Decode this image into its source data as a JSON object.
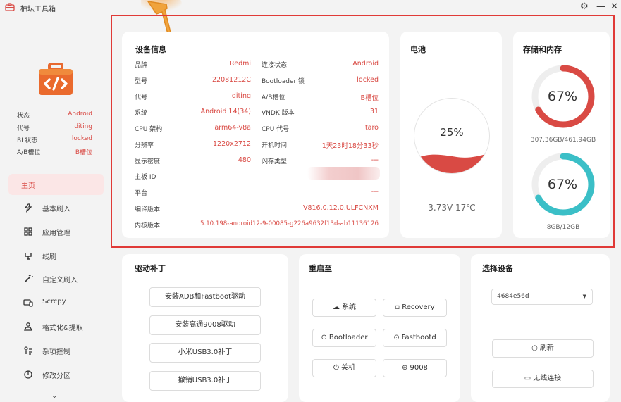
{
  "app": {
    "title": "柚坛工具箱"
  },
  "window": {
    "settings_icon": "gear-icon",
    "minimize": "—",
    "close": "✕"
  },
  "sidebar": {
    "info": [
      {
        "key": "状态",
        "value": "Android"
      },
      {
        "key": "代号",
        "value": "diting"
      },
      {
        "key": "BL状态",
        "value": "locked"
      },
      {
        "key": "A/B槽位",
        "value": "B槽位"
      }
    ],
    "nav": [
      {
        "label": "主页",
        "icon": "home",
        "active": true
      },
      {
        "label": "基本刷入",
        "icon": "flash-icon"
      },
      {
        "label": "应用管理",
        "icon": "apps-icon"
      },
      {
        "label": "线刷",
        "icon": "usb-icon"
      },
      {
        "label": "自定义刷入",
        "icon": "wand-icon"
      },
      {
        "label": "Scrcpy",
        "icon": "screen-cast-icon"
      },
      {
        "label": "格式化&提取",
        "icon": "format-icon"
      },
      {
        "label": "杂项控制",
        "icon": "misc-icon"
      },
      {
        "label": "修改分区",
        "icon": "partition-icon"
      }
    ],
    "more": "⌄"
  },
  "device": {
    "title": "设备信息",
    "left": [
      {
        "key": "品牌",
        "value": "Redmi"
      },
      {
        "key": "型号",
        "value": "22081212C"
      },
      {
        "key": "代号",
        "value": "diting"
      },
      {
        "key": "系统",
        "value": "Android 14(34)"
      },
      {
        "key": "CPU 架构",
        "value": "arm64-v8a"
      },
      {
        "key": "分辨率",
        "value": "1220x2712"
      },
      {
        "key": "显示密度",
        "value": "480"
      }
    ],
    "right": [
      {
        "key": "连接状态",
        "value": "Android"
      },
      {
        "key": "Bootloader 锁",
        "value": "locked"
      },
      {
        "key": "A/B槽位",
        "value": "B槽位"
      },
      {
        "key": "VNDK 版本",
        "value": "31"
      },
      {
        "key": "CPU 代号",
        "value": "taro"
      },
      {
        "key": "开机时间",
        "value": "1天23时18分33秒"
      },
      {
        "key": "闪存类型",
        "value": "---"
      }
    ],
    "full": [
      {
        "key": "主板 ID",
        "value": ""
      },
      {
        "key": "平台",
        "value": "---"
      },
      {
        "key": "编译版本",
        "value": "V816.0.12.0.ULFCNXM"
      },
      {
        "key": "内核版本",
        "value": "5.10.198-android12-9-00085-g226a9632f13d-ab11136126"
      }
    ]
  },
  "battery": {
    "title": "电池",
    "percent": "25%",
    "level": 0.25,
    "status": "3.73V 17℃"
  },
  "storage": {
    "title": "存储和内存",
    "storage_percent": "67%",
    "storage_fraction": 0.67,
    "storage_detail": "307.36GB/461.94GB",
    "memory_percent": "67%",
    "memory_fraction": 0.67,
    "memory_detail": "8GB/12GB"
  },
  "drivers": {
    "title": "驱动补丁",
    "buttons": [
      "安装ADB和Fastboot驱动",
      "安装高通9008驱动",
      "小米USB3.0补丁",
      "撤销USB3.0补丁"
    ]
  },
  "reboot": {
    "title": "重启至",
    "buttons": [
      {
        "label": "系统",
        "icon": "cloud-icon"
      },
      {
        "label": "Recovery",
        "icon": "recovery-icon"
      },
      {
        "label": "Bootloader",
        "icon": "bootloader-icon"
      },
      {
        "label": "Fastbootd",
        "icon": "fastbootd-icon"
      },
      {
        "label": "关机",
        "icon": "power-icon"
      },
      {
        "label": "9008",
        "icon": "edl-icon"
      }
    ]
  },
  "select_device": {
    "title": "选择设备",
    "value": "4684e56d",
    "refresh": "刷新",
    "wireless": "无线连接"
  },
  "colors": {
    "accent": "#d94a44",
    "memory": "#3bbfc7",
    "highlight": "#e03a37"
  }
}
